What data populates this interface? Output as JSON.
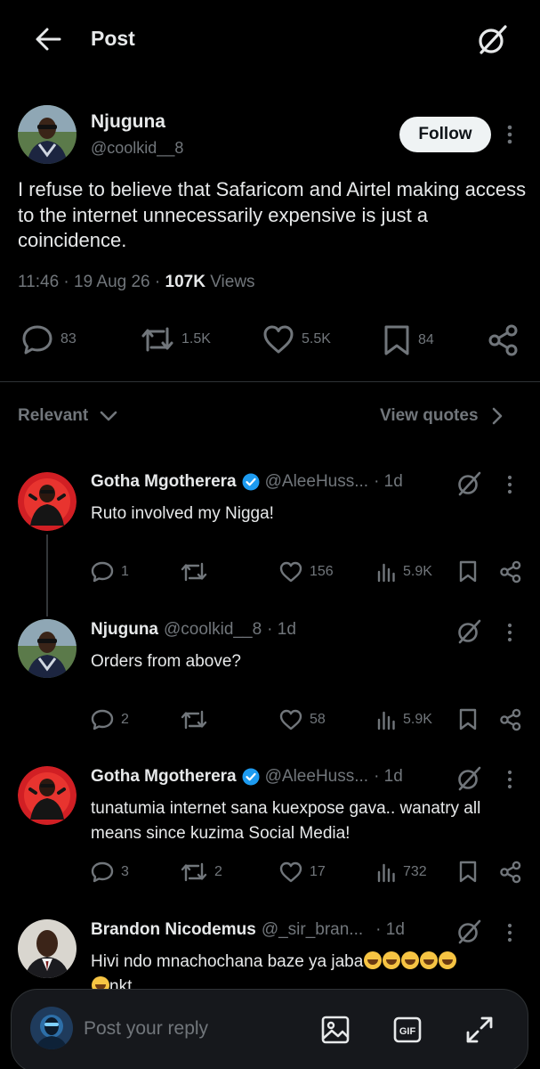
{
  "header": {
    "title": "Post"
  },
  "post": {
    "author_name": "Njuguna",
    "author_handle": "@coolkid__8",
    "follow_label": "Follow",
    "text": "I refuse to believe that Safaricom and Airtel making access to the internet unnecessarily expensive is just a coincidence.",
    "time": "11:46",
    "sep1": " · ",
    "date": "19 Aug 26",
    "sep2": " · ",
    "views_count": "107K",
    "views_label": " Views",
    "stats": {
      "replies": "83",
      "reposts": "1.5K",
      "likes": "5.5K",
      "bookmarks": "84"
    }
  },
  "sort": {
    "label": "Relevant",
    "view_quotes": "View quotes"
  },
  "replies": [
    {
      "name": "Gotha Mgotherera",
      "verified": true,
      "handle": "@AleeHuss...",
      "time": "· 1d",
      "text": "Ruto involved my Nigga!",
      "stats": {
        "replies": "1",
        "reposts": "",
        "likes": "156",
        "views": "5.9K"
      }
    },
    {
      "name": "Njuguna",
      "verified": false,
      "handle": "@coolkid__8",
      "time": "· 1d",
      "text": "Orders from above?",
      "stats": {
        "replies": "2",
        "reposts": "",
        "likes": "58",
        "views": "5.9K"
      }
    },
    {
      "name": "Gotha Mgotherera",
      "verified": true,
      "handle": "@AleeHuss...",
      "time": "· 1d",
      "text": "tunatumia internet sana kuexpose gava.. wanatry all means since kuzima Social Media!",
      "stats": {
        "replies": "3",
        "reposts": "2",
        "likes": "17",
        "views": "732"
      }
    },
    {
      "name": "Brandon Nicodemus",
      "verified": false,
      "handle": "@_sir_bran...",
      "time": "· 1d",
      "text": "Hivi ndo mnachochana baze ya jaba",
      "text_tail": "nkt"
    }
  ],
  "reply_bar": {
    "placeholder": "Post your reply",
    "gif_label": "GIF"
  },
  "colors": {
    "background": "#000000",
    "text": "#e7e9ea",
    "muted": "#71767b",
    "verified": "#1d9bf0",
    "follow_bg": "#eff3f4"
  }
}
